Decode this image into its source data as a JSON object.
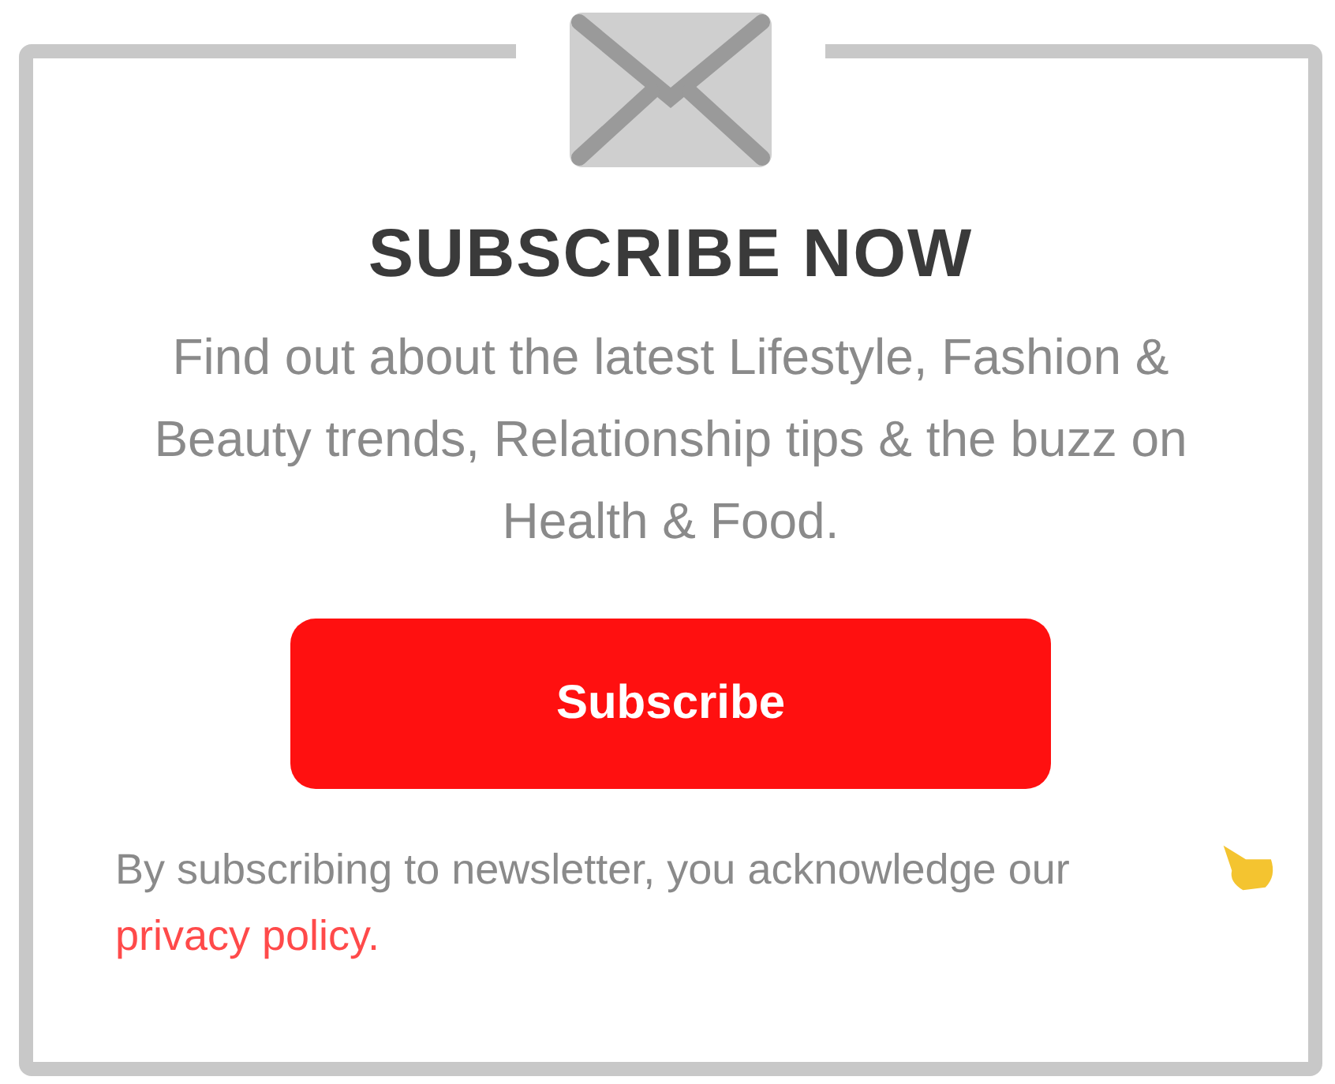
{
  "card": {
    "title": "SUBSCRIBE NOW",
    "description": "Find out about the latest Lifestyle, Fashion & Beauty trends, Relationship tips & the buzz on Health & Food.",
    "button": "Subscribe",
    "disclaimer": "By subscribing to newsletter, you acknowledge our",
    "link": "privacy policy."
  }
}
